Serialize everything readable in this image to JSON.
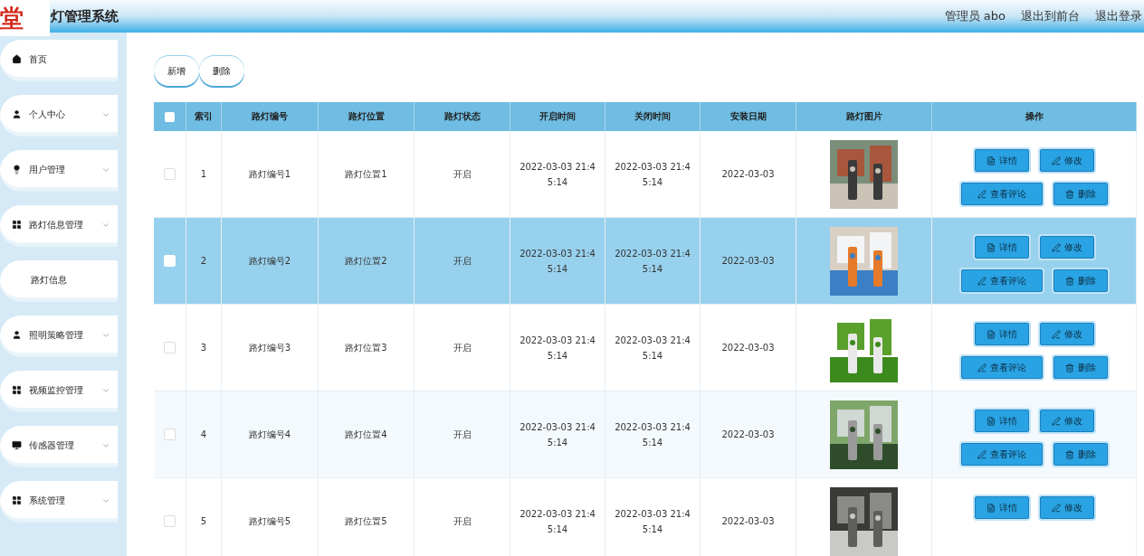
{
  "header": {
    "logo": "堂",
    "title": "灯管理系统",
    "user": "管理员 abo",
    "links": [
      "退出到前台",
      "退出登录"
    ]
  },
  "sidebar": {
    "items": [
      {
        "label": "首页"
      },
      {
        "label": "个人中心",
        "has_arrow": true
      },
      {
        "label": "用户管理",
        "has_arrow": true
      },
      {
        "label": "路灯信息管理",
        "has_arrow": true,
        "children": [
          {
            "label": "路灯信息"
          }
        ]
      },
      {
        "label": "照明策略管理",
        "has_arrow": true
      },
      {
        "label": "视频监控管理",
        "has_arrow": true
      },
      {
        "label": "传感器管理",
        "has_arrow": true
      },
      {
        "label": "系统管理",
        "has_arrow": true
      }
    ]
  },
  "toolbar": [
    "新增",
    "删除"
  ],
  "table": {
    "select_all": {
      "checked": false
    },
    "columns": [
      "索引",
      "路灯编号",
      "路灯位置",
      "路灯状态",
      "开启时间",
      "关闭时间",
      "安装日期",
      "路灯图片",
      "操作"
    ],
    "rows": [
      {
        "selected": false,
        "cells": [
          "1",
          "路灯编号1",
          "路灯位置1",
          "开启",
          "2022-03-03 21:45:14",
          "2022-03-03 21:45:14",
          "2022-03-03"
        ],
        "picture": {
          "kind": "picture"
        },
        "actions": [
          "详情",
          "修改",
          "查看评论",
          "删除"
        ]
      },
      {
        "selected": true,
        "cells": [
          "2",
          "路灯编号2",
          "路灯位置2",
          "开启",
          "2022-03-03 21:45:14",
          "2022-03-03 21:45:14",
          "2022-03-03"
        ],
        "picture": {
          "kind": "picture"
        },
        "actions": [
          "详情",
          "修改",
          "查看评论",
          "删除"
        ]
      },
      {
        "selected": false,
        "cells": [
          "3",
          "路灯编号3",
          "路灯位置3",
          "开启",
          "2022-03-03 21:45:14",
          "2022-03-03 21:45:14",
          "2022-03-03"
        ],
        "picture": {
          "kind": "picture"
        },
        "actions": [
          "详情",
          "修改",
          "查看评论",
          "删除"
        ]
      },
      {
        "selected": false,
        "cells": [
          "4",
          "路灯编号4",
          "路灯位置4",
          "开启",
          "2022-03-03 21:45:14",
          "2022-03-03 21:45:14",
          "2022-03-03"
        ],
        "picture": {
          "kind": "picture"
        },
        "actions": [
          "详情",
          "修改",
          "查看评论",
          "删除"
        ]
      },
      {
        "selected": false,
        "cells": [
          "5",
          "路灯编号5",
          "路灯位置5",
          "开启",
          "2022-03-03 21:45:14",
          "2022-03-03 21:45:14",
          "2022-03-03"
        ],
        "picture": {
          "kind": "picture"
        },
        "actions": [
          "详情",
          "修改"
        ]
      }
    ]
  }
}
